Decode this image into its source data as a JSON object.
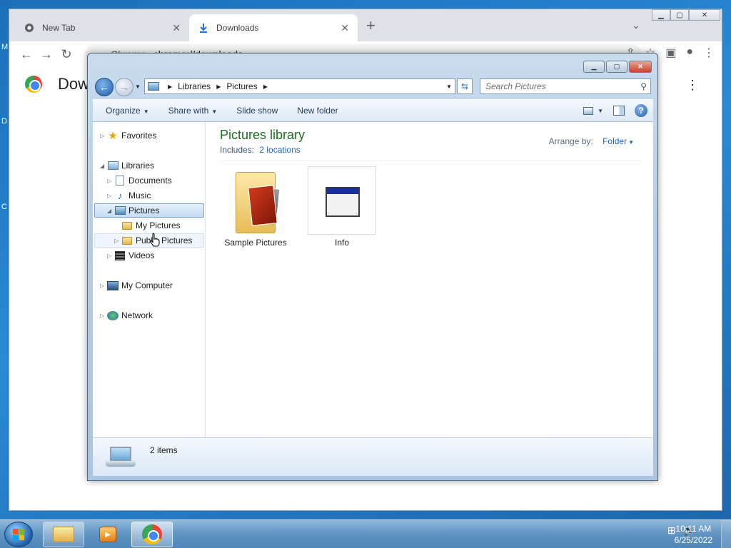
{
  "desktop": {
    "fragments": [
      "M",
      "D",
      "C"
    ]
  },
  "chrome": {
    "tabs": [
      {
        "label": "New Tab",
        "icon": "chrome-icon"
      },
      {
        "label": "Downloads",
        "icon": "download-icon"
      }
    ],
    "new_tab_symbol": "+",
    "omnibox": {
      "site": "Chrome",
      "url": "chrome://downloads"
    },
    "page_title": "Dow",
    "window_buttons": {
      "minimize": "▁",
      "maximize": "▢",
      "close": "✕"
    }
  },
  "explorer": {
    "breadcrumb": [
      "Libraries",
      "Pictures"
    ],
    "search_placeholder": "Search Pictures",
    "commands": {
      "organize": "Organize",
      "share_with": "Share with",
      "slide_show": "Slide show",
      "new_folder": "New folder"
    },
    "nav": {
      "favorites": "Favorites",
      "libraries": "Libraries",
      "documents": "Documents",
      "music": "Music",
      "pictures": "Pictures",
      "my_pictures": "My Pictures",
      "public_pictures": "Public Pictures",
      "videos": "Videos",
      "my_computer": "My Computer",
      "network": "Network"
    },
    "library": {
      "title": "Pictures library",
      "includes_label": "Includes:",
      "includes_link": "2 locations",
      "arrange_label": "Arrange by:",
      "arrange_value": "Folder"
    },
    "items": [
      {
        "label": "Sample Pictures",
        "type": "folder"
      },
      {
        "label": "Info",
        "type": "file"
      }
    ],
    "status": {
      "count": "2 items"
    }
  },
  "taskbar": {
    "clock": {
      "time": "10:11 AM",
      "date": "6/25/2022"
    }
  }
}
